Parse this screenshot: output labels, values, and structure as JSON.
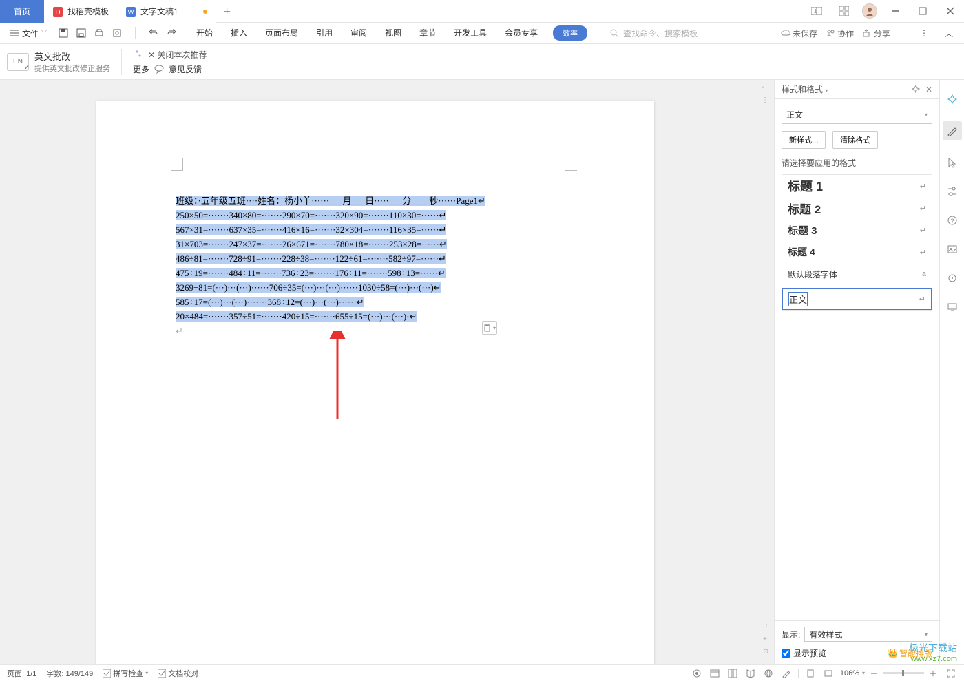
{
  "tabs": {
    "home": "首页",
    "template": "找稻壳模板",
    "doc": "文字文稿1"
  },
  "menu": {
    "file": "文件",
    "items": [
      "开始",
      "插入",
      "页面布局",
      "引用",
      "审阅",
      "视图",
      "章节",
      "开发工具",
      "会员专享"
    ],
    "pill": "效率",
    "search": "查找命令、搜索模板",
    "unsaved": "未保存",
    "collab": "协作",
    "share": "分享"
  },
  "toolbar": {
    "en_title": "英文批改",
    "en_sub": "提供英文批改修正服务",
    "more": "更多",
    "close_rec": "关闭本次推荐",
    "feedback": "意见反馈"
  },
  "doc": {
    "lines": [
      "班级：·五年级五班····姓名：杨小羊······___月___日·····___分____秒······Page1↵",
      "250×50=·······340×80=·······290×70=·······320×90=·······110×30=······↵",
      "567×31=·······637×35=·······416×16=·······32×304=·······116×35=······↵",
      "31×703=·······247×37=·······26×671=·······780×18=·······253×28=······↵",
      "486÷81=·······728÷91=·······228÷38=·······122÷61=·······582÷97=······↵",
      "475÷19=·······484÷11=·······736÷23=·······176÷11=·······598÷13=······↵",
      "3269÷81=(···)···(···)······706÷35=(···)···(···)······1030÷58=(···)···(···)↵",
      "585÷17=(···)···(···)·······368÷12=(···)···(···)······↵",
      "20×484=·······357÷51=·······420÷15=·······655÷15=(···)···(···)·↵"
    ]
  },
  "panel": {
    "title": "样式和格式",
    "current": "正文",
    "new_style": "新样式...",
    "clear": "清除格式",
    "apply_label": "请选择要应用的格式",
    "items": [
      {
        "label": "标题 1",
        "cls": "rp-item-h1"
      },
      {
        "label": "标题 2",
        "cls": "rp-item-h2"
      },
      {
        "label": "标题 3",
        "cls": "rp-item-h3"
      },
      {
        "label": "标题 4",
        "cls": "rp-item-h4"
      },
      {
        "label": "默认段落字体",
        "cls": "rp-item-df",
        "sym": "a"
      },
      {
        "label": "正文",
        "cls": "rp-item-zw"
      }
    ],
    "show": "显示:",
    "show_val": "有效样式",
    "preview": "显示预览",
    "smart": "智能排版"
  },
  "status": {
    "page": "页面: 1/1",
    "words": "字数: 149/149",
    "spell": "拼写检查",
    "proof": "文档校对",
    "zoom": "106%"
  },
  "watermark": {
    "l1": "极光下载站",
    "l2": "www.xz7.com"
  }
}
